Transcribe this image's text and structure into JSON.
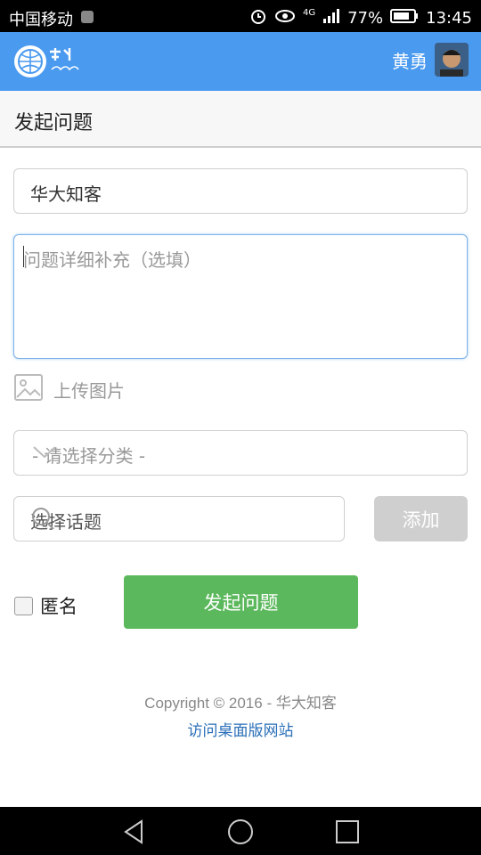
{
  "status_bar": {
    "carrier": "中国移动",
    "network": "4G",
    "battery": "77%",
    "time": "13:45",
    "icons": [
      "sim-icon",
      "alarm-icon",
      "eye-icon",
      "signal-icon",
      "battery-icon"
    ]
  },
  "header": {
    "logo_icon": "huada-logo-icon",
    "user_name": "黄勇",
    "avatar_icon": "user-avatar"
  },
  "page": {
    "title": "发起问题"
  },
  "form": {
    "title_value": "华大知客",
    "detail_placeholder": "问题详细补充（选填）",
    "upload_label": "上传图片",
    "category_placeholder": "- 请选择分类 -",
    "topic_placeholder": "选择话题",
    "add_label": "添加",
    "anonymous_label": "匿名",
    "submit_label": "发起问题"
  },
  "footer": {
    "copyright": "Copyright © 2016 - 华大知客",
    "desktop_link": "访问桌面版网站"
  },
  "colors": {
    "header": "#4a9af0",
    "submit": "#5cb85c",
    "add_disabled": "#cfcfcf",
    "link": "#2a6fb8"
  }
}
